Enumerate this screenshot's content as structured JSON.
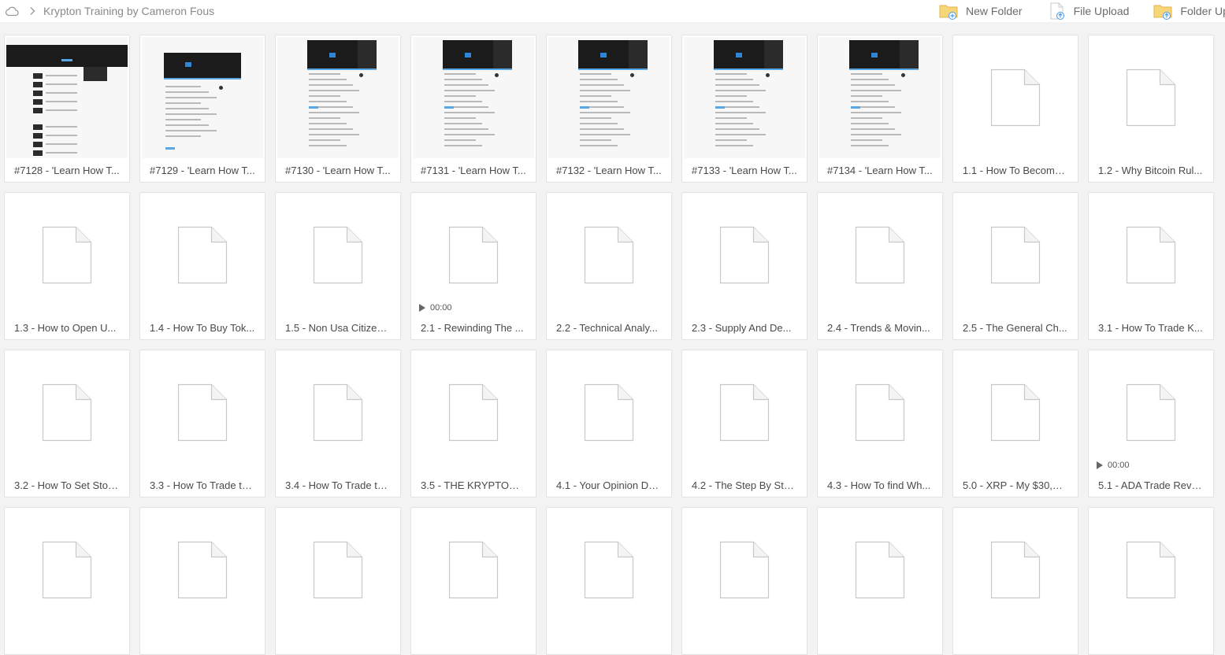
{
  "breadcrumb": {
    "title": "Krypton Training by Cameron Fous"
  },
  "actions": {
    "new_folder": "New Folder",
    "file_upload": "File Upload",
    "folder_upload": "Folder Upload"
  },
  "files": [
    {
      "name": "#7128 - 'Learn How T...",
      "thumb": "screenshot"
    },
    {
      "name": "#7129 - 'Learn How T...",
      "thumb": "screenshot"
    },
    {
      "name": "#7130 - 'Learn How T...",
      "thumb": "screenshot"
    },
    {
      "name": "#7131 - 'Learn How T...",
      "thumb": "screenshot"
    },
    {
      "name": "#7132 - 'Learn How T...",
      "thumb": "screenshot"
    },
    {
      "name": "#7133 - 'Learn How T...",
      "thumb": "screenshot"
    },
    {
      "name": "#7134 - 'Learn How T...",
      "thumb": "screenshot"
    },
    {
      "name": "1.1 - How To Become...",
      "thumb": "document"
    },
    {
      "name": "1.2 - Why Bitcoin Rul...",
      "thumb": "document"
    },
    {
      "name": "1.3 - How to Open U...",
      "thumb": "document"
    },
    {
      "name": "1.4 - How To Buy Tok...",
      "thumb": "document"
    },
    {
      "name": "1.5 - Non Usa Citizen...",
      "thumb": "document"
    },
    {
      "name": "2.1 - Rewinding The ...",
      "thumb": "document",
      "media_time": "00:00"
    },
    {
      "name": "2.2 - Technical Analy...",
      "thumb": "document"
    },
    {
      "name": "2.3 - Supply And De...",
      "thumb": "document"
    },
    {
      "name": "2.4 - Trends & Movin...",
      "thumb": "document"
    },
    {
      "name": "2.5 - The General Ch...",
      "thumb": "document"
    },
    {
      "name": "3.1 - How To Trade K...",
      "thumb": "document"
    },
    {
      "name": "3.2 - How To Set Stop...",
      "thumb": "document"
    },
    {
      "name": "3.3 - How To Trade th...",
      "thumb": "document"
    },
    {
      "name": "3.4 - How To Trade th...",
      "thumb": "document"
    },
    {
      "name": "3.5 - THE KRYPTONIT...",
      "thumb": "document"
    },
    {
      "name": "4.1 - Your Opinion Do...",
      "thumb": "document"
    },
    {
      "name": "4.2 - The Step By Ste...",
      "thumb": "document"
    },
    {
      "name": "4.3 - How To find Wh...",
      "thumb": "document"
    },
    {
      "name": "5.0 - XRP - My $30,00...",
      "thumb": "document"
    },
    {
      "name": "5.1 - ADA Trade Revie...",
      "thumb": "document",
      "media_time": "00:00"
    },
    {
      "name": "",
      "thumb": "document"
    },
    {
      "name": "",
      "thumb": "document"
    },
    {
      "name": "",
      "thumb": "document"
    },
    {
      "name": "",
      "thumb": "document"
    },
    {
      "name": "",
      "thumb": "document"
    },
    {
      "name": "",
      "thumb": "document"
    },
    {
      "name": "",
      "thumb": "document"
    },
    {
      "name": "",
      "thumb": "document"
    },
    {
      "name": "",
      "thumb": "document"
    }
  ],
  "icons": {
    "breadcrumb_root": "cloud-icon",
    "separator": "chevron-right-icon",
    "new_folder": "folder-plus-icon",
    "file_upload": "file-upload-icon",
    "folder_upload": "folder-upload-icon",
    "file": "document-icon",
    "media": "play-icon"
  },
  "colors": {
    "background": "#f3f3f3",
    "tile": "#ffffff",
    "folder": "#f0c24a",
    "upload_arrow": "#4a9be8"
  }
}
